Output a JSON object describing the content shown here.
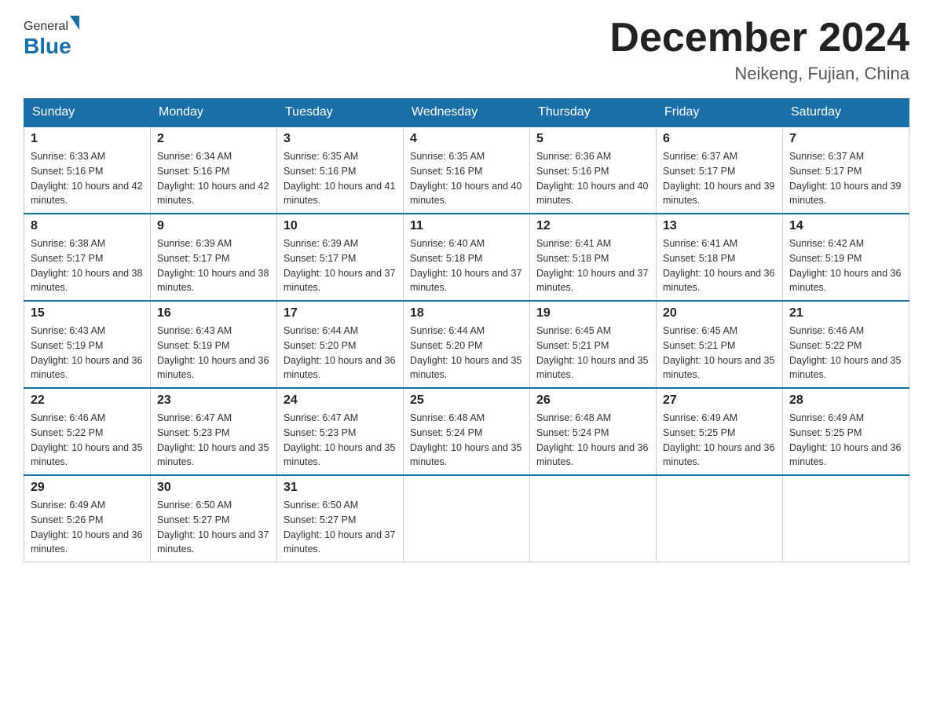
{
  "header": {
    "logo_general": "General",
    "logo_blue": "Blue",
    "month_title": "December 2024",
    "location": "Neikeng, Fujian, China"
  },
  "days_of_week": [
    "Sunday",
    "Monday",
    "Tuesday",
    "Wednesday",
    "Thursday",
    "Friday",
    "Saturday"
  ],
  "weeks": [
    [
      {
        "day": "1",
        "sunrise": "6:33 AM",
        "sunset": "5:16 PM",
        "daylight": "10 hours and 42 minutes."
      },
      {
        "day": "2",
        "sunrise": "6:34 AM",
        "sunset": "5:16 PM",
        "daylight": "10 hours and 42 minutes."
      },
      {
        "day": "3",
        "sunrise": "6:35 AM",
        "sunset": "5:16 PM",
        "daylight": "10 hours and 41 minutes."
      },
      {
        "day": "4",
        "sunrise": "6:35 AM",
        "sunset": "5:16 PM",
        "daylight": "10 hours and 40 minutes."
      },
      {
        "day": "5",
        "sunrise": "6:36 AM",
        "sunset": "5:16 PM",
        "daylight": "10 hours and 40 minutes."
      },
      {
        "day": "6",
        "sunrise": "6:37 AM",
        "sunset": "5:17 PM",
        "daylight": "10 hours and 39 minutes."
      },
      {
        "day": "7",
        "sunrise": "6:37 AM",
        "sunset": "5:17 PM",
        "daylight": "10 hours and 39 minutes."
      }
    ],
    [
      {
        "day": "8",
        "sunrise": "6:38 AM",
        "sunset": "5:17 PM",
        "daylight": "10 hours and 38 minutes."
      },
      {
        "day": "9",
        "sunrise": "6:39 AM",
        "sunset": "5:17 PM",
        "daylight": "10 hours and 38 minutes."
      },
      {
        "day": "10",
        "sunrise": "6:39 AM",
        "sunset": "5:17 PM",
        "daylight": "10 hours and 37 minutes."
      },
      {
        "day": "11",
        "sunrise": "6:40 AM",
        "sunset": "5:18 PM",
        "daylight": "10 hours and 37 minutes."
      },
      {
        "day": "12",
        "sunrise": "6:41 AM",
        "sunset": "5:18 PM",
        "daylight": "10 hours and 37 minutes."
      },
      {
        "day": "13",
        "sunrise": "6:41 AM",
        "sunset": "5:18 PM",
        "daylight": "10 hours and 36 minutes."
      },
      {
        "day": "14",
        "sunrise": "6:42 AM",
        "sunset": "5:19 PM",
        "daylight": "10 hours and 36 minutes."
      }
    ],
    [
      {
        "day": "15",
        "sunrise": "6:43 AM",
        "sunset": "5:19 PM",
        "daylight": "10 hours and 36 minutes."
      },
      {
        "day": "16",
        "sunrise": "6:43 AM",
        "sunset": "5:19 PM",
        "daylight": "10 hours and 36 minutes."
      },
      {
        "day": "17",
        "sunrise": "6:44 AM",
        "sunset": "5:20 PM",
        "daylight": "10 hours and 36 minutes."
      },
      {
        "day": "18",
        "sunrise": "6:44 AM",
        "sunset": "5:20 PM",
        "daylight": "10 hours and 35 minutes."
      },
      {
        "day": "19",
        "sunrise": "6:45 AM",
        "sunset": "5:21 PM",
        "daylight": "10 hours and 35 minutes."
      },
      {
        "day": "20",
        "sunrise": "6:45 AM",
        "sunset": "5:21 PM",
        "daylight": "10 hours and 35 minutes."
      },
      {
        "day": "21",
        "sunrise": "6:46 AM",
        "sunset": "5:22 PM",
        "daylight": "10 hours and 35 minutes."
      }
    ],
    [
      {
        "day": "22",
        "sunrise": "6:46 AM",
        "sunset": "5:22 PM",
        "daylight": "10 hours and 35 minutes."
      },
      {
        "day": "23",
        "sunrise": "6:47 AM",
        "sunset": "5:23 PM",
        "daylight": "10 hours and 35 minutes."
      },
      {
        "day": "24",
        "sunrise": "6:47 AM",
        "sunset": "5:23 PM",
        "daylight": "10 hours and 35 minutes."
      },
      {
        "day": "25",
        "sunrise": "6:48 AM",
        "sunset": "5:24 PM",
        "daylight": "10 hours and 35 minutes."
      },
      {
        "day": "26",
        "sunrise": "6:48 AM",
        "sunset": "5:24 PM",
        "daylight": "10 hours and 36 minutes."
      },
      {
        "day": "27",
        "sunrise": "6:49 AM",
        "sunset": "5:25 PM",
        "daylight": "10 hours and 36 minutes."
      },
      {
        "day": "28",
        "sunrise": "6:49 AM",
        "sunset": "5:25 PM",
        "daylight": "10 hours and 36 minutes."
      }
    ],
    [
      {
        "day": "29",
        "sunrise": "6:49 AM",
        "sunset": "5:26 PM",
        "daylight": "10 hours and 36 minutes."
      },
      {
        "day": "30",
        "sunrise": "6:50 AM",
        "sunset": "5:27 PM",
        "daylight": "10 hours and 37 minutes."
      },
      {
        "day": "31",
        "sunrise": "6:50 AM",
        "sunset": "5:27 PM",
        "daylight": "10 hours and 37 minutes."
      },
      null,
      null,
      null,
      null
    ]
  ]
}
